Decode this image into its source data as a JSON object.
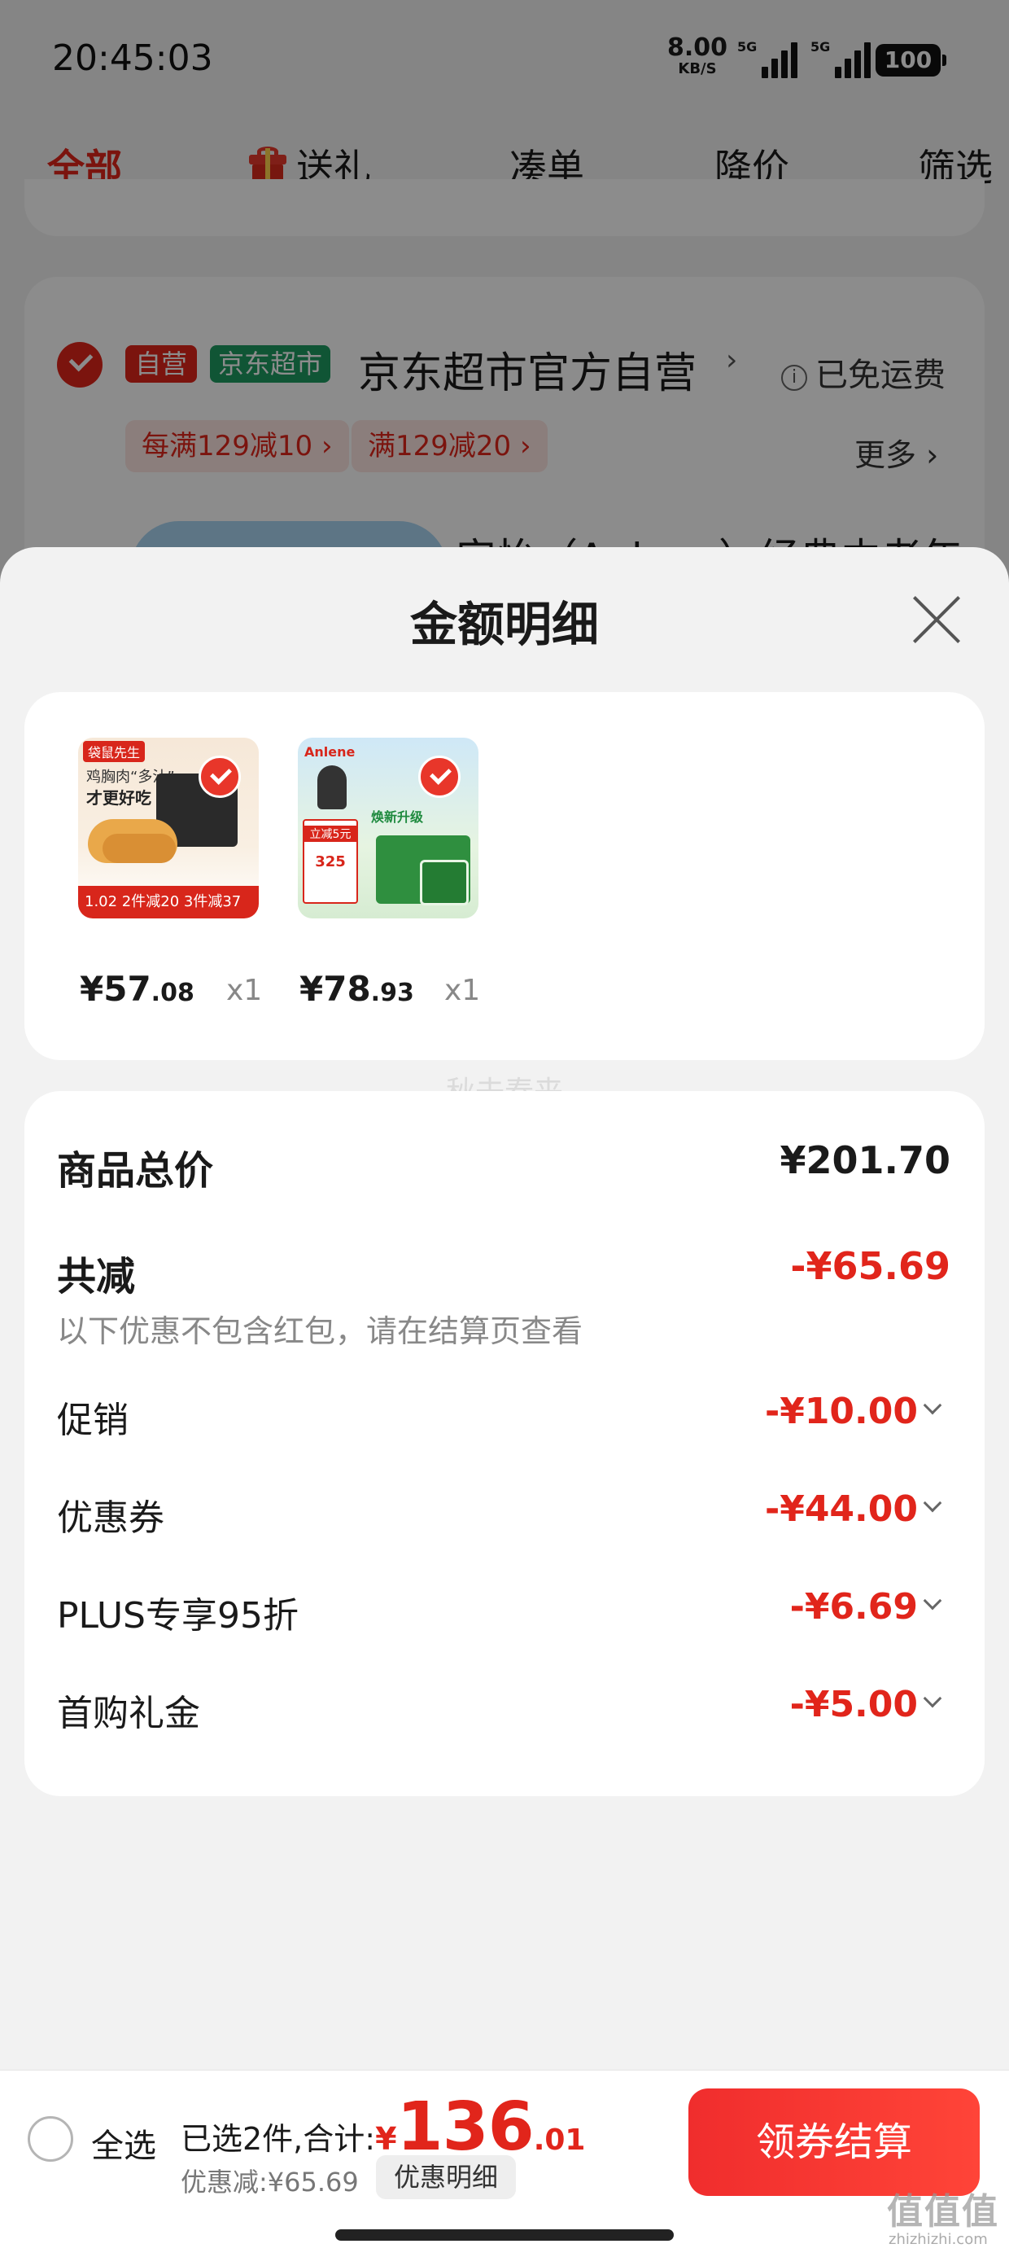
{
  "status_bar": {
    "time": "20:45:03",
    "net_speed": "8.00",
    "net_unit": "KB/S",
    "sim1": "5G",
    "sim2": "5G",
    "battery": "100"
  },
  "tabs": [
    {
      "label": "全部",
      "active": true
    },
    {
      "label": "送礼",
      "icon": "gift-icon"
    },
    {
      "label": "凑单"
    },
    {
      "label": "降价"
    },
    {
      "label": "筛选"
    }
  ],
  "shop": {
    "badge_self": "自营",
    "badge_mart": "京东超市",
    "name": "京东超市官方自营",
    "shipping": "已免运费",
    "promos": [
      "每满129减10 ›",
      "满129减20 ›"
    ],
    "more": "更多 ›",
    "product_title_peek": "安怡（Anlene）经典中老年"
  },
  "sheet": {
    "title": "金额明细",
    "items": [
      {
        "thumb": {
          "brand": "袋鼠先生",
          "line1": "鸡胸肉“多汁”",
          "line2": "才更好吃",
          "bar": "1.02 2件减20 3件减37"
        },
        "price_int": "¥57",
        "price_dec": ".08",
        "qty": "x1"
      },
      {
        "thumb": {
          "brand": "Anlene",
          "upgrade": "焕新升级",
          "tag": "立减5元",
          "price": "325"
        },
        "price_int": "¥78",
        "price_dec": ".93",
        "qty": "x1"
      }
    ],
    "watermark": "秋去春来",
    "total_label": "商品总价",
    "total_value": "¥201.70",
    "reduce_label": "共减",
    "reduce_value": "-¥65.69",
    "reduce_note": "以下优惠不包含红包，请在结算页查看",
    "discounts": [
      {
        "label": "促销",
        "value": "-¥10.00"
      },
      {
        "label": "优惠券",
        "value": "-¥44.00"
      },
      {
        "label": "PLUS专享95折",
        "value": "-¥6.69"
      },
      {
        "label": "首购礼金",
        "value": "-¥5.00"
      }
    ]
  },
  "bottom": {
    "select_all": "全选",
    "selected_label": "已选2件,合计:",
    "currency": "¥",
    "amount_int": "136",
    "amount_dec": ".01",
    "saved": "优惠减:¥65.69",
    "detail_button": "优惠明细",
    "checkout_button": "领券结算"
  },
  "corner": {
    "logo": "值值值",
    "url": "zhizhizhi.com"
  },
  "colors": {
    "accent": "#e1251b",
    "mart_green": "#1e9b62",
    "checkout": "#f02d2d"
  }
}
